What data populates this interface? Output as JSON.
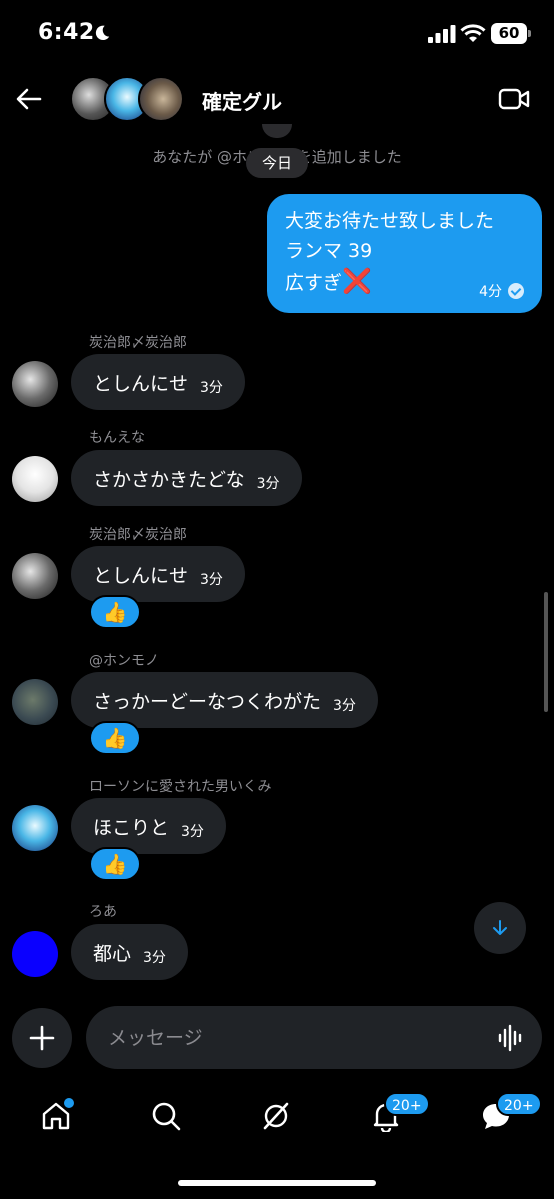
{
  "status_bar": {
    "time": "6:42",
    "battery": "60"
  },
  "header": {
    "title": "確定グル"
  },
  "chat": {
    "system_message": "あなたが @ホンモノ を追加しました",
    "day_label": "今日",
    "sent": {
      "lines": [
        "大変お待たせ致しました",
        "ランマ 39",
        "広すぎ"
      ],
      "mark": "❌",
      "time": "4分"
    },
    "messages": [
      {
        "sender": "炭治郎〆炭治郎",
        "text": "としんにせ",
        "time": "3分",
        "reaction": ""
      },
      {
        "sender": "もんえな",
        "text": "さかさかきたどな",
        "time": "3分",
        "reaction": ""
      },
      {
        "sender": "炭治郎〆炭治郎",
        "text": "としんにせ",
        "time": "3分",
        "reaction": "👍"
      },
      {
        "sender": "@ホンモノ",
        "text": "さっかーどーなつくわがた",
        "time": "3分",
        "reaction": "👍"
      },
      {
        "sender": "ローソンに愛された男いくみ",
        "text": "ほこりと",
        "time": "3分",
        "reaction": "👍"
      },
      {
        "sender": "ろあ",
        "text": "都心",
        "time": "3分",
        "reaction": ""
      }
    ]
  },
  "composer": {
    "placeholder": "メッセージ"
  },
  "nav": {
    "notifications_badge": "20+",
    "messages_badge": "20+",
    "items": [
      "home-icon",
      "search-icon",
      "grok-icon",
      "bell-icon",
      "messages-icon"
    ]
  },
  "colors": {
    "accent": "#1d9bf0",
    "bubble": "#202327",
    "background": "#000000"
  }
}
